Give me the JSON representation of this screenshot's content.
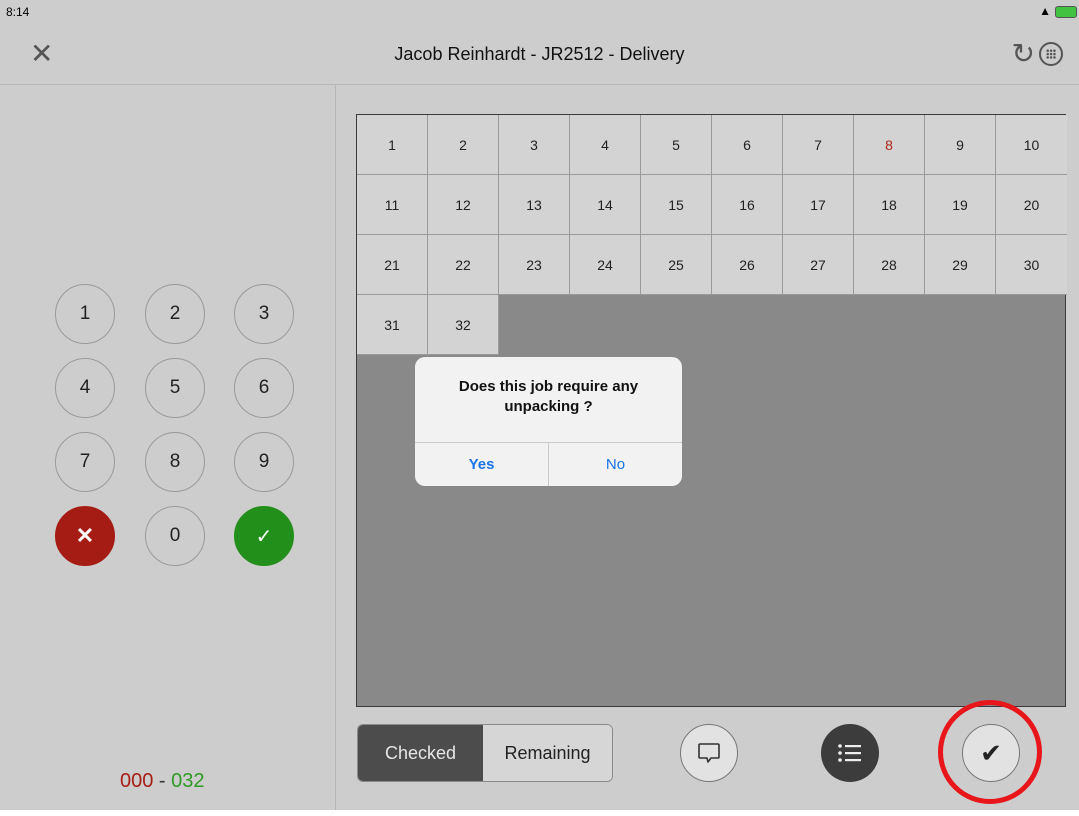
{
  "status": {
    "time": "8:14"
  },
  "header": {
    "title": "Jacob Reinhardt - JR2512 - Delivery"
  },
  "keypad": {
    "keys": [
      "1",
      "2",
      "3",
      "4",
      "5",
      "6",
      "7",
      "8",
      "9",
      "0"
    ]
  },
  "counter": {
    "checked": "000",
    "separator": " - ",
    "total": "032"
  },
  "grid": {
    "cells": [
      "1",
      "2",
      "3",
      "4",
      "5",
      "6",
      "7",
      "8",
      "9",
      "10",
      "11",
      "12",
      "13",
      "14",
      "15",
      "16",
      "17",
      "18",
      "19",
      "20",
      "21",
      "22",
      "23",
      "24",
      "25",
      "26",
      "27",
      "28",
      "29",
      "30",
      "31",
      "32"
    ],
    "flagged": [
      "8"
    ],
    "flag_color": "#b0261b"
  },
  "dialog": {
    "message": "Does this job require any unpacking ?",
    "yes_label": "Yes",
    "no_label": "No"
  },
  "footer": {
    "checked_label": "Checked",
    "remaining_label": "Remaining"
  },
  "colors": {
    "cancel": "#a51c14",
    "confirm": "#238f1b",
    "accent_blue": "#1a73e8",
    "highlight": "#e8161b"
  }
}
